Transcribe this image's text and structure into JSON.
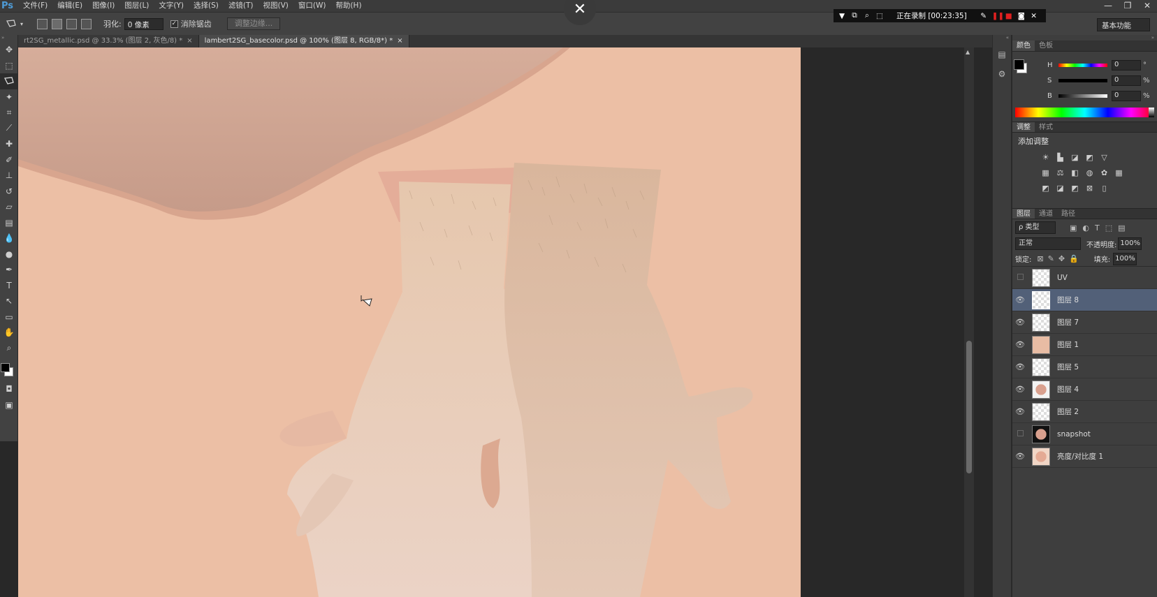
{
  "app": {
    "logo": "Ps"
  },
  "menu": [
    "文件(F)",
    "编辑(E)",
    "图像(I)",
    "图层(L)",
    "文字(Y)",
    "选择(S)",
    "滤镜(T)",
    "视图(V)",
    "窗口(W)",
    "帮助(H)"
  ],
  "window_controls": [
    "—",
    "❐",
    "✕"
  ],
  "options": {
    "feather_label": "羽化:",
    "feather_value": "0 像素",
    "antialias_label": "消除锯齿",
    "antialias_check": "✓",
    "refine_edge": "调整边缘...",
    "workspace": "基本功能"
  },
  "overlay_close": "✕",
  "recorder": {
    "status": "正在录制 [00:23:35]"
  },
  "tabs": [
    {
      "label": "rt2SG_metallic.psd @ 33.3% (图层 2, 灰色/8) *",
      "close": "×"
    },
    {
      "label": "lambert2SG_basecolor.psd @ 100% (图层 8, RGB/8*) *",
      "close": "×"
    }
  ],
  "color_panel": {
    "tabs": [
      "颜色",
      "色板"
    ],
    "sliders": [
      {
        "label": "H",
        "value": "0",
        "unit": "°"
      },
      {
        "label": "S",
        "value": "0",
        "unit": "%"
      },
      {
        "label": "B",
        "value": "0",
        "unit": "%"
      }
    ]
  },
  "adjust_panel": {
    "tabs": [
      "调整",
      "样式"
    ],
    "title": "添加调整"
  },
  "layers_panel": {
    "tabs": [
      "图层",
      "通道",
      "路径"
    ],
    "filter": "ρ 类型",
    "blend": "正常",
    "opacity_label": "不透明度:",
    "opacity_value": "100%",
    "lock_label": "锁定:",
    "fill_label": "填充:",
    "fill_value": "100%",
    "layers": [
      {
        "name": "UV",
        "visible": false,
        "selected": false
      },
      {
        "name": "图层 8",
        "visible": true,
        "selected": true
      },
      {
        "name": "图层 7",
        "visible": true,
        "selected": false
      },
      {
        "name": "图层 1",
        "visible": true,
        "selected": false
      },
      {
        "name": "图层 5",
        "visible": true,
        "selected": false
      },
      {
        "name": "图层 4",
        "visible": true,
        "selected": false
      },
      {
        "name": "图层 2",
        "visible": true,
        "selected": false
      },
      {
        "name": "snapshot",
        "visible": false,
        "selected": false
      },
      {
        "name": "亮度/对比度 1",
        "visible": true,
        "selected": false
      }
    ]
  },
  "colors": {
    "canvas_bg": "#ecbfa5",
    "selected_layer": "#526078",
    "recorder_red": "#e02020"
  }
}
